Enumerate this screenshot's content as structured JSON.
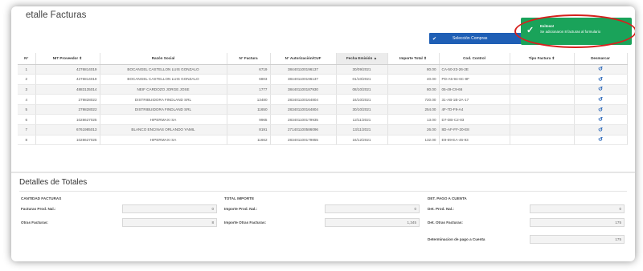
{
  "header": {
    "title": "etalle Facturas",
    "select_button": "Selección Compras"
  },
  "toast": {
    "title": "Exitoso!",
    "message": "Se adicionaron 8 facturas al formulario"
  },
  "table": {
    "columns": [
      "N°",
      "NIT Proveedor ⇕",
      "Razón Social",
      "N° Factura",
      "N° Autorización/CUF",
      "Fecha Emisión ▲",
      "Importe Total ⇕",
      "Cod. Control",
      "Tipo Factura ⇕",
      "Desmarcar"
    ],
    "rows": [
      [
        "1",
        "4276814019",
        "BOCANGEL CASTELLON LUIS GONZALO",
        "6719",
        "384401100196137",
        "30/09/2021",
        "80.00",
        "CA-50-23-26-2E",
        "",
        "↺"
      ],
      [
        "2",
        "4276814019",
        "BOCANGEL CASTELLON LUIS GONZALO",
        "6803",
        "384401100196137",
        "01/10/2021",
        "40.00",
        "PD-A5-94-6C-8F",
        "",
        "↺"
      ],
      [
        "3",
        "4883135014",
        "NEIF CARDOZO JORGE JOSE",
        "1777",
        "384401100187930",
        "08/10/2021",
        "80.00",
        "05-49-C9-66",
        "",
        "↺"
      ],
      [
        "4",
        "279828022",
        "DISTRIBUIDORA FINDLAND SRL",
        "13480",
        "283401100164804",
        "16/10/2021",
        "720.00",
        "31-AB-1B-2A-17",
        "",
        "↺"
      ],
      [
        "5",
        "279828022",
        "DISTRIBUIDORA FINDLAND SRL",
        "11650",
        "283401100164804",
        "30/10/2021",
        "254.00",
        "4F-7D-F9-A4",
        "",
        "↺"
      ],
      [
        "6",
        "1028627025",
        "HIPERMAXI SA",
        "9965",
        "283401100179935",
        "12/11/2021",
        "13.00",
        "D7-DB-C2-83",
        "",
        "↺"
      ],
      [
        "7",
        "6761985013",
        "BLANCO ENCINAS ORLANDO YAMIL",
        "8191",
        "271401100586096",
        "13/11/2021",
        "26.00",
        "8D-AF-FF-20-E8",
        "",
        "↺"
      ],
      [
        "8",
        "1028627025",
        "HIPERMAXI SA",
        "11662",
        "283401100179855",
        "16/12/2021",
        "132.00",
        "E9-69-EA-46-93",
        "",
        "↺"
      ]
    ]
  },
  "totals": {
    "title": "Detalles de Totales",
    "col1": {
      "heading": "CANTIDAD FACTURAS",
      "label1": "Facturas Prod. Nal.:",
      "value1": "0",
      "label2": "Otras Facturas:",
      "value2": "8"
    },
    "col2": {
      "heading": "TOTAL IMPORTE",
      "label1": "Importe Prod. Nal.:",
      "value1": "0",
      "label2": "Importe Otras Facturas:",
      "value2": "1,345"
    },
    "col3": {
      "heading": "DET. PAGO A CUENTA",
      "label1": "Det. Prod. Nal.:",
      "value1": "0",
      "label2": "Det. Otras Facturas:",
      "value2": "175",
      "label3": "Determinacion de pago a Cuenta",
      "value3": "175"
    }
  }
}
